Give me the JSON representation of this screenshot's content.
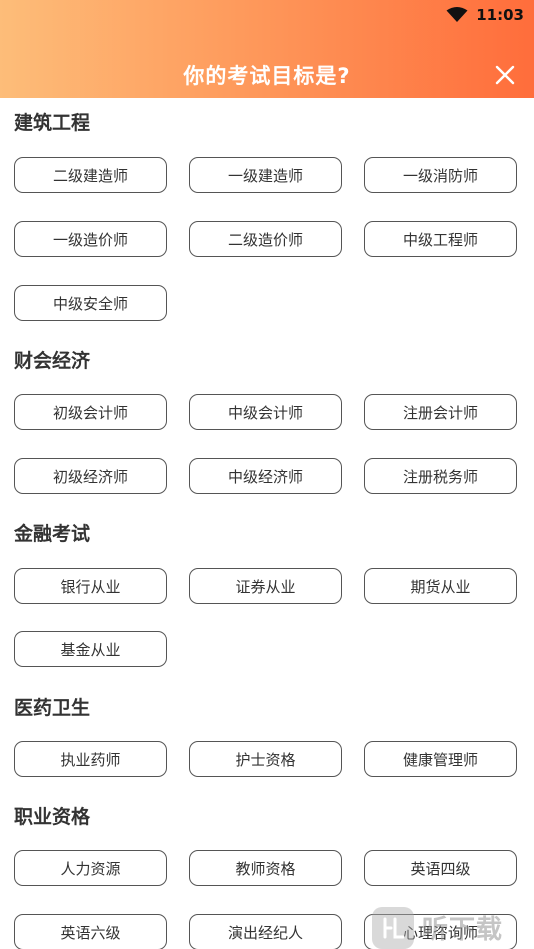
{
  "status_bar": {
    "time": "11:03"
  },
  "header": {
    "title": "你的考试目标是?"
  },
  "sections": [
    {
      "title": "建筑工程",
      "items": [
        "二级建造师",
        "一级建造师",
        "一级消防师",
        "一级造价师",
        "二级造价师",
        "中级工程师",
        "中级安全师"
      ]
    },
    {
      "title": "财会经济",
      "items": [
        "初级会计师",
        "中级会计师",
        "注册会计师",
        "初级经济师",
        "中级经济师",
        "注册税务师"
      ]
    },
    {
      "title": "金融考试",
      "items": [
        "银行从业",
        "证券从业",
        "期货从业",
        "基金从业"
      ]
    },
    {
      "title": "医药卫生",
      "items": [
        "执业药师",
        "护士资格",
        "健康管理师"
      ]
    },
    {
      "title": "职业资格",
      "items": [
        "人力资源",
        "教师资格",
        "英语四级",
        "英语六级",
        "演出经纪人",
        "心理咨询师"
      ]
    }
  ],
  "watermark": {
    "text": "听下载"
  }
}
